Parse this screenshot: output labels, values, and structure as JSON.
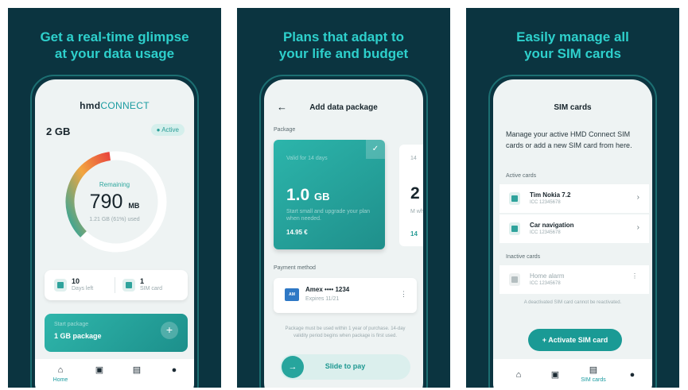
{
  "screen1": {
    "caption": [
      "Get a real-time glimpse",
      "at your data usage"
    ],
    "logo_a": "hmd",
    "logo_b": "CONNECT",
    "plan": "2 GB",
    "status": "Active",
    "gauge": {
      "label": "Remaining",
      "value": "790",
      "unit": "MB",
      "sub": "1.21 GB (61%) used",
      "used_fraction": 0.61
    },
    "stats": [
      {
        "num": "10",
        "label": "Days left"
      },
      {
        "num": "1",
        "label": "SIM card"
      }
    ],
    "start": {
      "label": "Start package",
      "title": "1 GB package",
      "plus": "+"
    },
    "nav": [
      {
        "icon": "home-icon",
        "label": "Home"
      },
      {
        "icon": "sim-icon",
        "label": ""
      },
      {
        "icon": "document-icon",
        "label": ""
      },
      {
        "icon": "user-icon",
        "label": ""
      }
    ]
  },
  "screen2": {
    "caption": [
      "Plans that adapt to",
      "your life and budget"
    ],
    "back": "←",
    "title": "Add data package",
    "section_package": "Package",
    "card1": {
      "valid": "Valid for 14 days",
      "size": "1.0",
      "unit": "GB",
      "desc": "Start small and upgrade your plan when needed.",
      "price": "14.95 €"
    },
    "card2": {
      "valid": "14",
      "size": "2",
      "desc": "M wh",
      "price": "14"
    },
    "section_payment": "Payment method",
    "payment": {
      "title": "Amex •••• 1234",
      "sub": "Expires 11/21"
    },
    "note": "Package must be used within 1 year of purchase. 14-day validity period begins when package is first used.",
    "slide": "Slide to pay"
  },
  "screen3": {
    "caption": [
      "Easily manage all",
      "your SIM cards"
    ],
    "title": "SIM cards",
    "intro": "Manage your active HMD Connect SIM cards or add a new SIM card from here.",
    "active_label": "Active cards",
    "active": [
      {
        "name": "Tim Nokia 7.2",
        "icc": "ICC 12345678"
      },
      {
        "name": "Car navigation",
        "icc": "ICC 12345678"
      }
    ],
    "inactive_label": "Inactive cards",
    "inactive": [
      {
        "name": "Home alarm",
        "icc": "ICC 12345678"
      }
    ],
    "deactivated_note": "A deactivated SIM card cannot be reactivated.",
    "activate": "+ Activate SIM card",
    "nav_label": "SIM cards"
  },
  "colors": {
    "background": "#0b3440",
    "accent": "#2ed0cc",
    "primary": "#1a9a95"
  }
}
